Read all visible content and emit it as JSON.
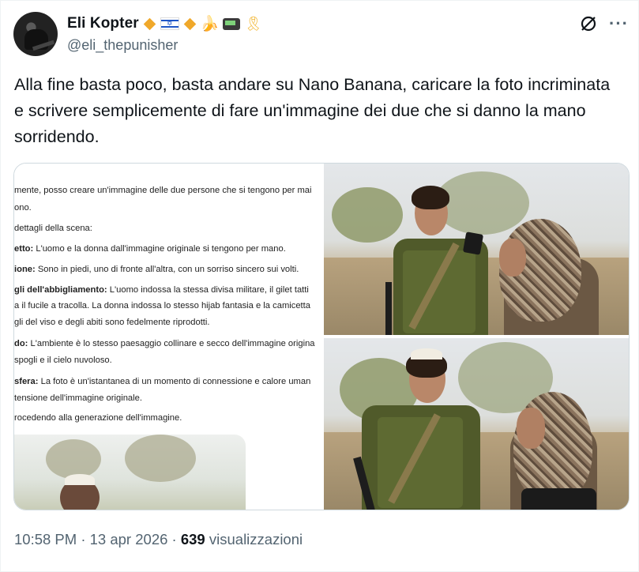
{
  "author": {
    "display_name": "Eli Kopter",
    "handle": "@eli_thepunisher",
    "badges": [
      "orange-diamond",
      "israel-flag",
      "orange-diamond",
      "banana",
      "pager",
      "yellow-ribbon"
    ],
    "avatar": "profile-avatar"
  },
  "header": {
    "grok_icon": "grok-icon",
    "more_label": "···"
  },
  "tweet": {
    "text": "Alla fine basta poco, basta andare su Nano Banana, caricare la foto incriminata e scrivere semplicemente di fare un'immagine dei due che si danno la mano sorridendo."
  },
  "media": {
    "gemini_screenshot": {
      "lines": [
        {
          "bold": "",
          "text": "mente, posso creare un'immagine delle due persone che si tengono per mai"
        },
        {
          "bold": "",
          "text": "ono."
        },
        {
          "bold": "",
          "text": "dettagli della scena:"
        },
        {
          "bold": "etto:",
          "text": " L'uomo e la donna dall'immagine originale si tengono per mano."
        },
        {
          "bold": "ione:",
          "text": " Sono in piedi, uno di fronte all'altra, con un sorriso sincero sui volti."
        },
        {
          "bold": "gli dell'abbigliamento:",
          "text": " L'uomo indossa la stessa divisa militare, il gilet tatti"
        },
        {
          "bold": "",
          "text": "a il fucile a tracolla. La donna indossa lo stesso hijab fantasia e la camicetta"
        },
        {
          "bold": "",
          "text": "gli del viso e degli abiti sono fedelmente riprodotti."
        },
        {
          "bold": "do:",
          "text": " L'ambiente è lo stesso paesaggio collinare e secco dell'immagine origina"
        },
        {
          "bold": "",
          "text": "spogli e il cielo nuvoloso."
        },
        {
          "bold": "sfera:",
          "text": " La foto è un'istantanea di un momento di connessione e calore uman"
        },
        {
          "bold": "",
          "text": "tensione dell'immagine originale."
        },
        {
          "bold": "",
          "text": "rocedendo alla generazione dell'immagine."
        }
      ]
    },
    "photos": [
      "original-photo-soldier-and-woman",
      "generated-photo-soldier-and-woman"
    ]
  },
  "meta": {
    "time": "10:58 PM",
    "sep1": "·",
    "date": "13 apr 2026",
    "sep2": "·",
    "views_count": "639",
    "views_label": "visualizzazioni"
  },
  "colors": {
    "text": "#0f1419",
    "secondary": "#536471",
    "border": "#cfd9de",
    "badge_gold": "#f0a82a"
  }
}
